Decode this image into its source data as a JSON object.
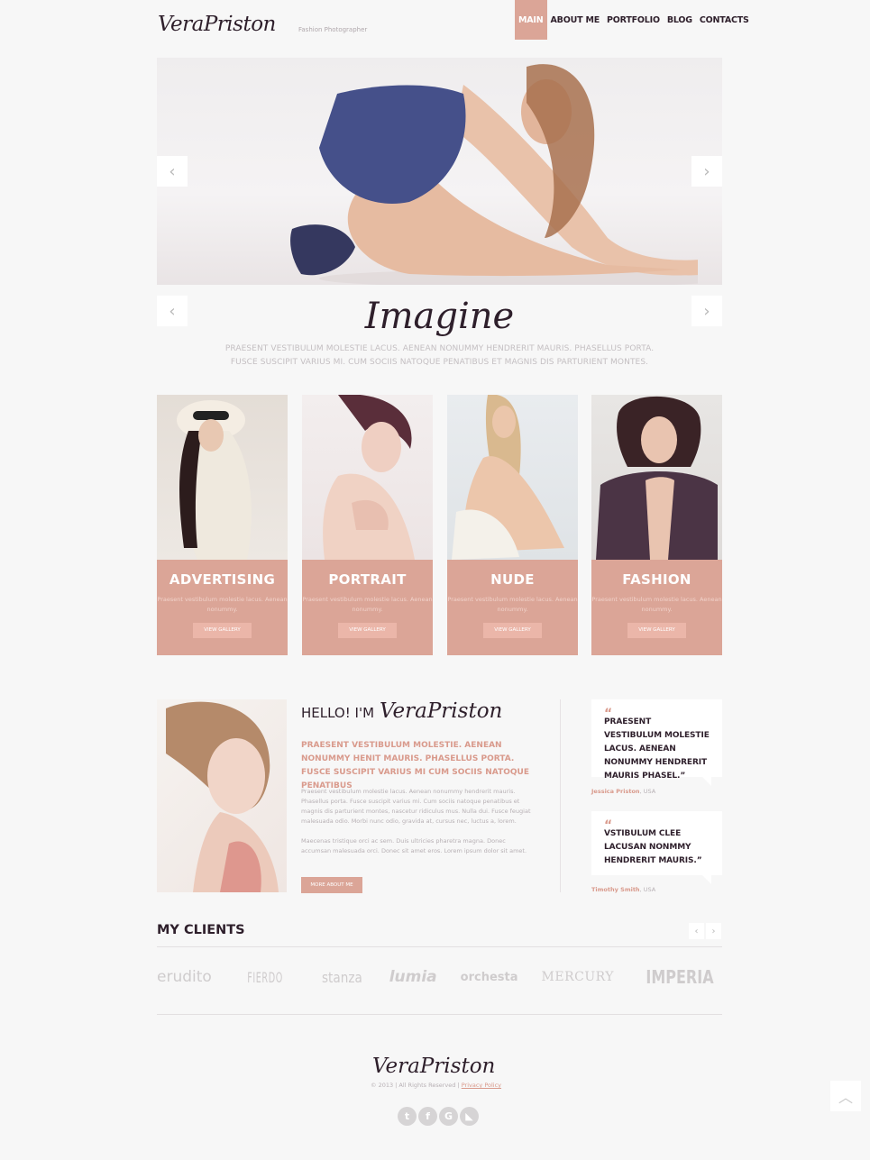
{
  "header": {
    "logo": "VeraPriston",
    "tagline": "Fashion Photographer",
    "nav": [
      {
        "label": "MAIN",
        "active": true
      },
      {
        "label": "ABOUT ME",
        "active": false
      },
      {
        "label": "PORTFOLIO",
        "active": false
      },
      {
        "label": "BLOG",
        "active": false
      },
      {
        "label": "CONTACTS",
        "active": false
      }
    ]
  },
  "slider": {
    "prev_icon": "‹",
    "next_icon": "›",
    "headline": "Imagine",
    "text": "PRAESENT VESTIBULUM MOLESTIE LACUS. AENEAN NONUMMY HENDRERIT MAURIS. PHASELLUS PORTA. FUSCE SUSCIPIT VARIUS MI. CUM SOCIIS NATOQUE PENATIBUS ET MAGNIS DIS PARTURIENT MONTES."
  },
  "galleries": [
    {
      "title": "ADVERTISING",
      "desc": "Praesent vestibulum molestie lacus. Aenean nonummy.",
      "button": "VIEW GALLERY"
    },
    {
      "title": "PORTRAIT",
      "desc": "Praesent vestibulum molestie lacus. Aenean nonummy.",
      "button": "VIEW GALLERY"
    },
    {
      "title": "NUDE",
      "desc": "Praesent vestibulum molestie lacus. Aenean nonummy.",
      "button": "VIEW GALLERY"
    },
    {
      "title": "FASHION",
      "desc": "Praesent vestibulum molestie lacus. Aenean nonummy.",
      "button": "VIEW GALLERY"
    }
  ],
  "about": {
    "hello": "HELLO! I'M",
    "name": "VeraPriston",
    "lead": "PRAESENT VESTIBULUM MOLESTIE. AENEAN NONUMMY HENIT MAURIS. PHASELLUS PORTA. FUSCE SUSCIPIT VARIUS MI CUM SOCIIS NATOQUE PENATIBUS",
    "para1": "Praesent vestibulum molestie lacus. Aenean nonummy hendrerit mauris. Phasellus porta. Fusce suscipit varius mi. Cum sociis natoque penatibus et magnis dis parturient montes, nascetur ridiculus mus. Nulla dui. Fusce feugiat malesuada odio. Morbi nunc odio, gravida at, cursus nec, luctus a, lorem.",
    "para2": "Maecenas tristique orci ac sem. Duis ultricies pharetra magna. Donec accumsan malesuada orci. Donec sit amet eros. Lorem ipsum dolor sit amet.",
    "button": "MORE ABOUT ME"
  },
  "testimonials": [
    {
      "quote": "PRAESENT VESTIBULUM MOLESTIE LACUS. AENEAN NONUMMY HENDRERIT MAURIS PHASEL.”",
      "author": "Jessica Priston",
      "location": ", USA"
    },
    {
      "quote": "VSTIBULUM CLEE LACUSAN NONMMY HENDRERIT MAURIS.”",
      "author": "Timothy Smith",
      "location": ", USA"
    }
  ],
  "clients": {
    "title": "MY CLIENTS",
    "prev_icon": "‹",
    "next_icon": "›",
    "logos": [
      "erudito",
      "FIERDO",
      "stanza",
      "lumia",
      "orchesta",
      "MERCURY",
      "IMPERIA"
    ]
  },
  "footer": {
    "logo": "VeraPriston",
    "copyright": "©  2013   |   All Rights Reserved   |",
    "privacy": "Privacy Policy",
    "socials": [
      {
        "name": "twitter",
        "glyph": "t"
      },
      {
        "name": "facebook",
        "glyph": "f"
      },
      {
        "name": "google",
        "glyph": "G"
      },
      {
        "name": "rss",
        "glyph": "◣"
      }
    ],
    "to_top_icon": "︿"
  },
  "colors": {
    "accent": "#dba597",
    "accent_text": "#d99a8c",
    "dark": "#2e1f2b",
    "bg": "#f7f7f7"
  }
}
